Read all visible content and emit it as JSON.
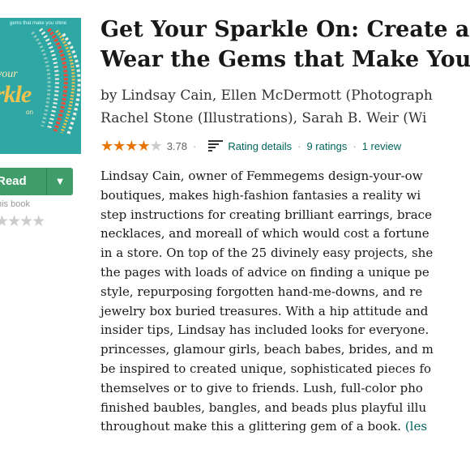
{
  "cover": {
    "topline": "gems that make you shine",
    "word1": "your",
    "word2": "rkle",
    "word3": "on"
  },
  "actions": {
    "read_label": "Read",
    "rate_label": "his book",
    "empty_stars": "★★★★"
  },
  "book": {
    "title_line1": "Get Your Sparkle On: Create an",
    "title_line2": "Wear the Gems that Make You",
    "byline_line1": "by Lindsay Cain, Ellen McDermott (Photograph",
    "byline_line2": "Rachel Stone (Illustrations), Sarah B. Weir (Wi"
  },
  "rating": {
    "value": "3.78",
    "stars_filled": "★★★★",
    "stars_empty": "★",
    "details_label": "Rating details",
    "ratings_count": "9 ratings",
    "reviews_count": "1 review",
    "sep": "·"
  },
  "description": {
    "lines": [
      "Lindsay Cain, owner of Femmegems design-your-ow",
      "boutiques, makes high-fashion fantasies a reality wi",
      "step instructions for creating brilliant earrings, brace",
      "necklaces, and moreall of which would cost a fortune",
      "in a store. On top of the 25 divinely easy projects, she",
      "the pages with loads of advice on finding a unique pe",
      "style, repurposing forgotten hand-me-downs, and re",
      "jewelry box buried treasures. With a hip attitude and",
      "insider tips, Lindsay has included looks for everyone.",
      "princesses, glamour girls, beach babes, brides, and m",
      "be inspired to created unique, sophisticated pieces fo",
      "themselves or to give to friends. Lush, full-color pho",
      "finished baubles, bangles, and beads plus playful illu"
    ],
    "last_line": "throughout make this a glittering gem of a book.",
    "more_link": "(les"
  },
  "colors": {
    "accent_green": "#409d69",
    "star_orange": "#e87400",
    "link_teal": "#00635d",
    "cover_teal": "#2fa8a5"
  }
}
